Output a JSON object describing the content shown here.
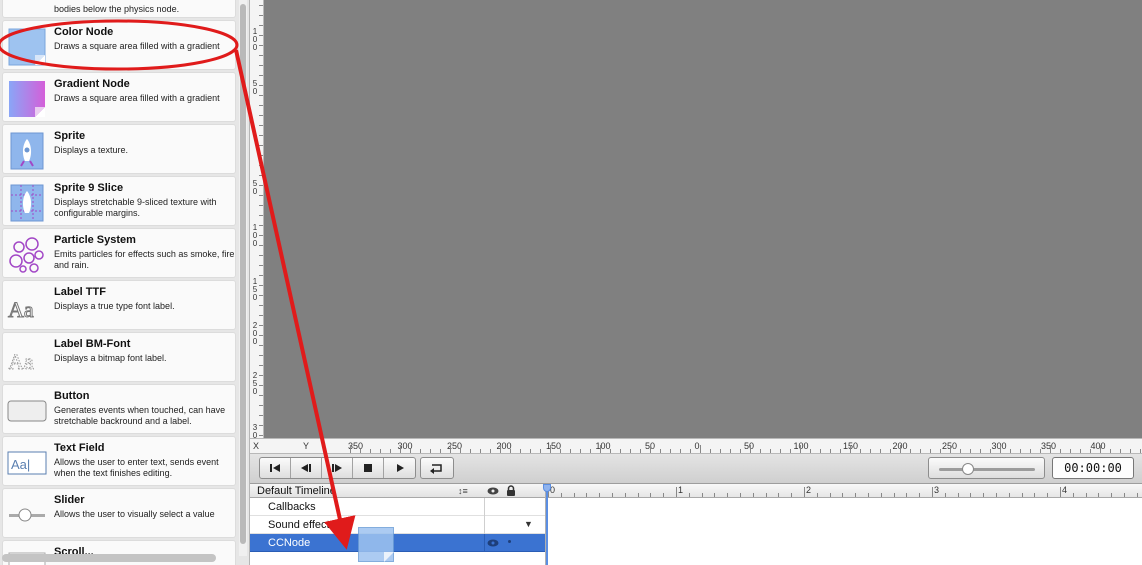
{
  "library": {
    "items": [
      {
        "name": "",
        "desc": "bodies below the physics node.",
        "icon": "physics-node-icon"
      },
      {
        "name": "Color Node",
        "desc": "Draws a square area filled with a gradient",
        "icon": "color-node-icon"
      },
      {
        "name": "Gradient Node",
        "desc": "Draws a square area filled with a gradient",
        "icon": "gradient-node-icon"
      },
      {
        "name": "Sprite",
        "desc": "Displays a texture.",
        "icon": "sprite-icon"
      },
      {
        "name": "Sprite 9 Slice",
        "desc": "Displays stretchable 9-sliced texture with configurable margins.",
        "icon": "sprite-9-slice-icon"
      },
      {
        "name": "Particle System",
        "desc": "Emits particles for effects such as smoke, fire and rain.",
        "icon": "particle-system-icon"
      },
      {
        "name": "Label TTF",
        "desc": "Displays a true type font label.",
        "icon": "label-ttf-icon"
      },
      {
        "name": "Label BM-Font",
        "desc": "Displays a bitmap font label.",
        "icon": "label-bmfont-icon"
      },
      {
        "name": "Button",
        "desc": "Generates events when touched, can have stretchable backround and a label.",
        "icon": "button-icon"
      },
      {
        "name": "Text Field",
        "desc": "Allows the user to enter text, sends event when the text finishes editing.",
        "icon": "text-field-icon"
      },
      {
        "name": "Slider",
        "desc": "Allows the user to visually select a value",
        "icon": "slider-icon"
      },
      {
        "name": "Scroll...",
        "desc": "",
        "icon": "scroll-view-icon"
      }
    ]
  },
  "vruler": {
    "labels": [
      "100",
      "50",
      "50",
      "100",
      "150",
      "200",
      "250",
      "300"
    ]
  },
  "hruler": {
    "axis_x": "X",
    "axis_y": "Y",
    "labels": [
      "350",
      "300",
      "250",
      "200",
      "150",
      "100",
      "50",
      "0",
      "50",
      "100",
      "150",
      "200",
      "250",
      "300",
      "350",
      "400"
    ]
  },
  "controls": {
    "buttons": [
      "skip-to-start",
      "step-back",
      "step-forward",
      "stop",
      "play"
    ],
    "loop": "loop-icon",
    "zoom_level": 0.3,
    "time": "00:00:00"
  },
  "timeline": {
    "title": "Default Timeline",
    "sort_glyph": "↕≡",
    "rows": [
      {
        "label": "Callbacks"
      },
      {
        "label": "Sound effects"
      },
      {
        "label": "CCNode"
      }
    ],
    "ruler_labels": [
      "0",
      "1",
      "2",
      "3",
      "4"
    ]
  },
  "annotation": {
    "color": "#e01b1b"
  }
}
